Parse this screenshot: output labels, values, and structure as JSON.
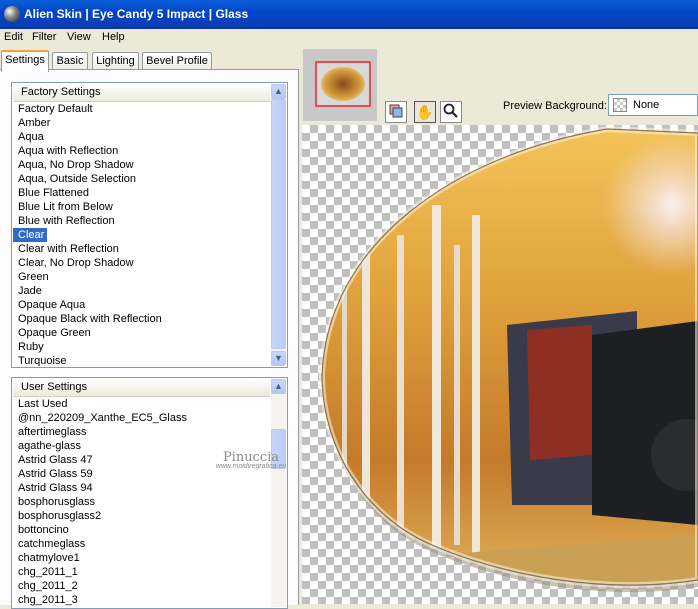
{
  "window": {
    "title": "Alien Skin | Eye Candy 5 Impact | Glass"
  },
  "menu": [
    "Edit",
    "Filter",
    "View",
    "Help"
  ],
  "tabs": [
    "Settings",
    "Basic",
    "Lighting",
    "Bevel Profile"
  ],
  "factory_settings": {
    "header": "Factory Settings",
    "items": [
      "Factory Default",
      "Amber",
      "Aqua",
      "Aqua with Reflection",
      "Aqua, No Drop Shadow",
      "Aqua, Outside Selection",
      "Blue Flattened",
      "Blue Lit from Below",
      "Blue with Reflection",
      "Clear",
      "Clear with Reflection",
      "Clear, No Drop Shadow",
      "Green",
      "Jade",
      "Opaque Aqua",
      "Opaque Black with Reflection",
      "Opaque Green",
      "Ruby",
      "Turquoise"
    ],
    "selected": "Clear"
  },
  "user_settings": {
    "header": "User Settings",
    "items": [
      "Last Used",
      "@nn_220209_Xanthe_EC5_Glass",
      "aftertimeglass",
      "agathe-glass",
      "Astrid Glass 47",
      "Astrid Glass 59",
      "Astrid Glass 94",
      "bosphorusglass",
      "bosphorusglass2",
      "bottoncino",
      "catchmeglass",
      "chatmylove1",
      "chg_2011_1",
      "chg_2011_2",
      "chg_2011_3"
    ]
  },
  "watermark": {
    "name": "Pinuccia",
    "url": "www.moidiregrafica.eu"
  },
  "preview_background": {
    "label": "Preview Background:",
    "value": "None"
  },
  "tools": [
    "preview-toggle-icon",
    "hand-icon",
    "zoom-icon"
  ]
}
